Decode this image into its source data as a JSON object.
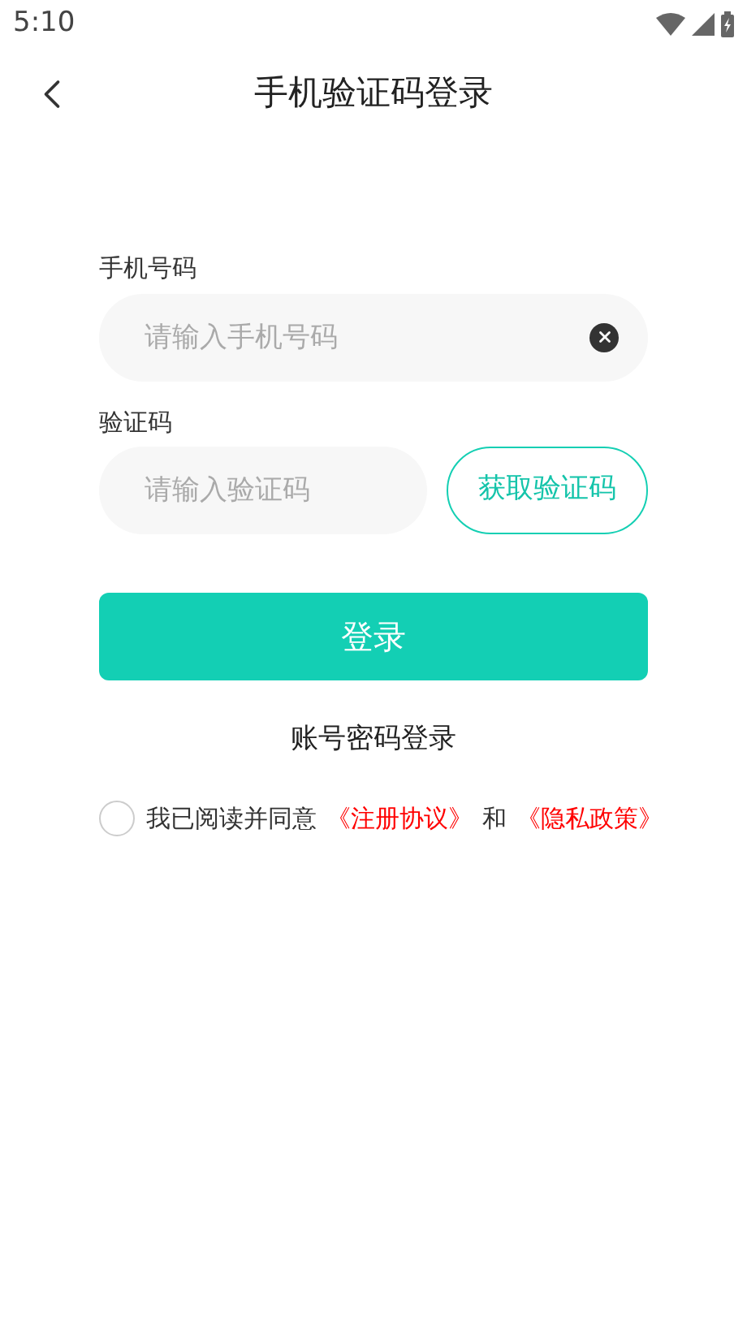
{
  "status_bar": {
    "time": "5:10"
  },
  "header": {
    "title": "手机验证码登录"
  },
  "phone": {
    "label": "手机号码",
    "placeholder": "请输入手机号码"
  },
  "code": {
    "label": "验证码",
    "placeholder": "请输入验证码",
    "button": "获取验证码"
  },
  "login_button": "登录",
  "alt_login": "账号密码登录",
  "agreement": {
    "checked": false,
    "text": "我已阅读并同意",
    "links": [
      "《注册协议》",
      "《隐私政策》"
    ],
    "joiner": "和"
  }
}
